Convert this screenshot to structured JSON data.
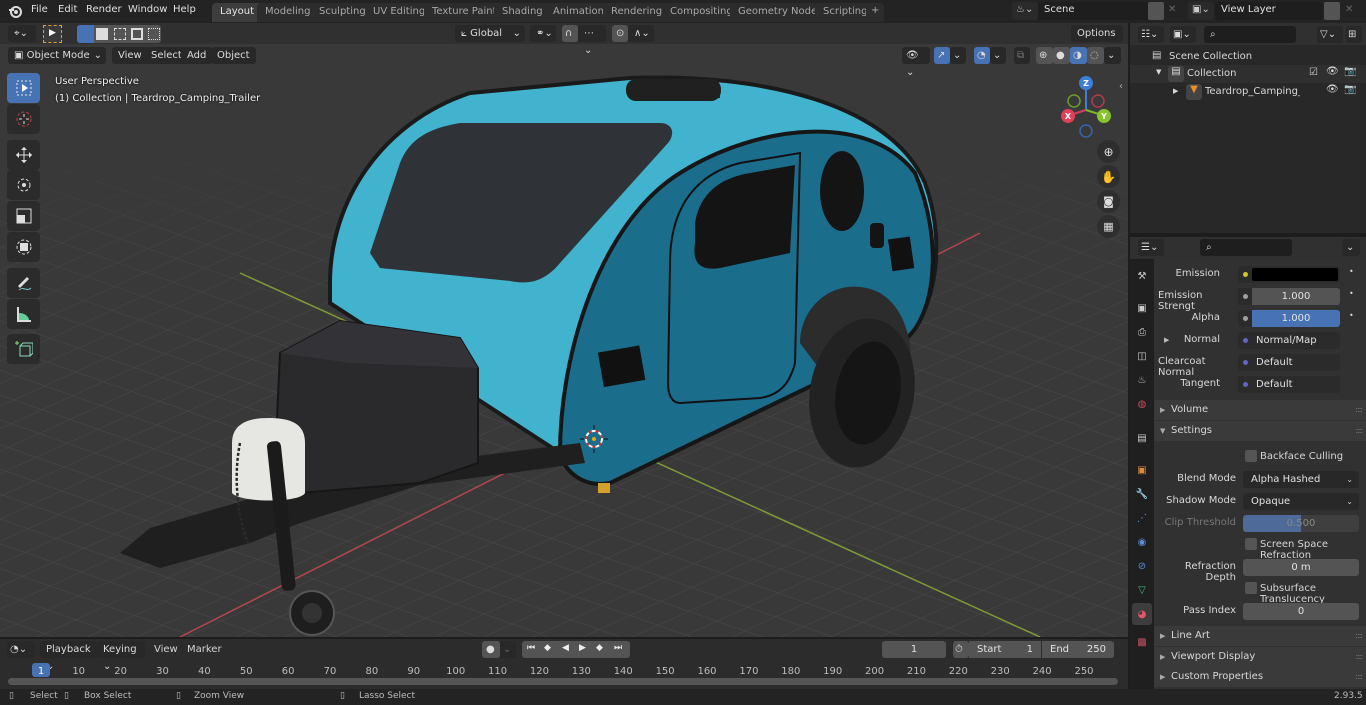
{
  "app": {
    "version": "2.93.5"
  },
  "menu": [
    "File",
    "Edit",
    "Render",
    "Window",
    "Help"
  ],
  "workspace_tabs": [
    {
      "label": "Layout",
      "active": true
    },
    {
      "label": "Modeling"
    },
    {
      "label": "Sculpting"
    },
    {
      "label": "UV Editing"
    },
    {
      "label": "Texture Paint"
    },
    {
      "label": "Shading"
    },
    {
      "label": "Animation"
    },
    {
      "label": "Rendering"
    },
    {
      "label": "Compositing"
    },
    {
      "label": "Geometry Nodes"
    },
    {
      "label": "Scripting"
    }
  ],
  "add_workspace": "+",
  "scene": {
    "name": "Scene",
    "view_layer": "View Layer"
  },
  "viewport_header": {
    "mode": "Object Mode",
    "menus": [
      "View",
      "Select",
      "Add",
      "Object"
    ],
    "transform_orientation": "Global",
    "options_label": "Options"
  },
  "viewport": {
    "perspective_label": "User Perspective",
    "collection_label": "(1) Collection | Teardrop_Camping_Trailer",
    "gizmo_axes": {
      "x": "X",
      "y": "Y",
      "z": "Z"
    },
    "colors": {
      "body": "#41b3ce",
      "body_dark": "#1a6a8a",
      "grid_bg": "#393939",
      "x_axis": "#c6434e",
      "y_axis": "#8ab23a"
    }
  },
  "tools": [
    "select-box",
    "cursor",
    "move",
    "rotate",
    "scale",
    "transform",
    "annotate",
    "measure",
    "add-cube"
  ],
  "outliner": {
    "rows": [
      {
        "label": "Scene Collection"
      },
      {
        "label": "Collection"
      },
      {
        "label": "Teardrop_Camping_Trailer"
      }
    ]
  },
  "properties": {
    "inputs": [
      {
        "label": "Emission",
        "value": "",
        "socket": "#d2c820"
      },
      {
        "label": "Emission Strengt",
        "value": "1.000",
        "socket": "#a0a0a0"
      },
      {
        "label": "Alpha",
        "value": "1.000",
        "socket": "#a0a0a0"
      },
      {
        "label": "Normal",
        "value": "Normal/Map",
        "socket": "#6464c8"
      },
      {
        "label": "Clearcoat Normal",
        "value": "Default",
        "socket": "#6464c8"
      },
      {
        "label": "Tangent",
        "value": "Default",
        "socket": "#6464c8"
      }
    ],
    "panels": {
      "volume": "Volume",
      "settings": "Settings",
      "line_art": "Line Art",
      "viewport_display": "Viewport Display",
      "custom_properties": "Custom Properties"
    },
    "settings": {
      "backface_culling": "Backface Culling",
      "blend_mode_label": "Blend Mode",
      "blend_mode": "Alpha Hashed",
      "shadow_mode_label": "Shadow Mode",
      "shadow_mode": "Opaque",
      "clip_threshold_label": "Clip Threshold",
      "clip_threshold": "0.500",
      "ssr": "Screen Space Refraction",
      "refraction_depth_label": "Refraction Depth",
      "refraction_depth": "0 m",
      "subsurface": "Subsurface Translucency",
      "pass_index_label": "Pass Index",
      "pass_index": "0"
    }
  },
  "timeline": {
    "menus": [
      "Playback",
      "Keying",
      "View",
      "Marker"
    ],
    "current_frame": "1",
    "start_label": "Start",
    "start": "1",
    "end_label": "End",
    "end": "250",
    "ticks": [
      "1",
      "10",
      "20",
      "30",
      "40",
      "50",
      "60",
      "70",
      "80",
      "90",
      "100",
      "110",
      "120",
      "130",
      "140",
      "150",
      "160",
      "170",
      "180",
      "190",
      "200",
      "210",
      "220",
      "230",
      "240",
      "250"
    ]
  },
  "statusbar": {
    "select": "Select",
    "box_select": "Box Select",
    "zoom_view": "Zoom View",
    "lasso_select": "Lasso Select",
    "version": "2.93.5"
  }
}
